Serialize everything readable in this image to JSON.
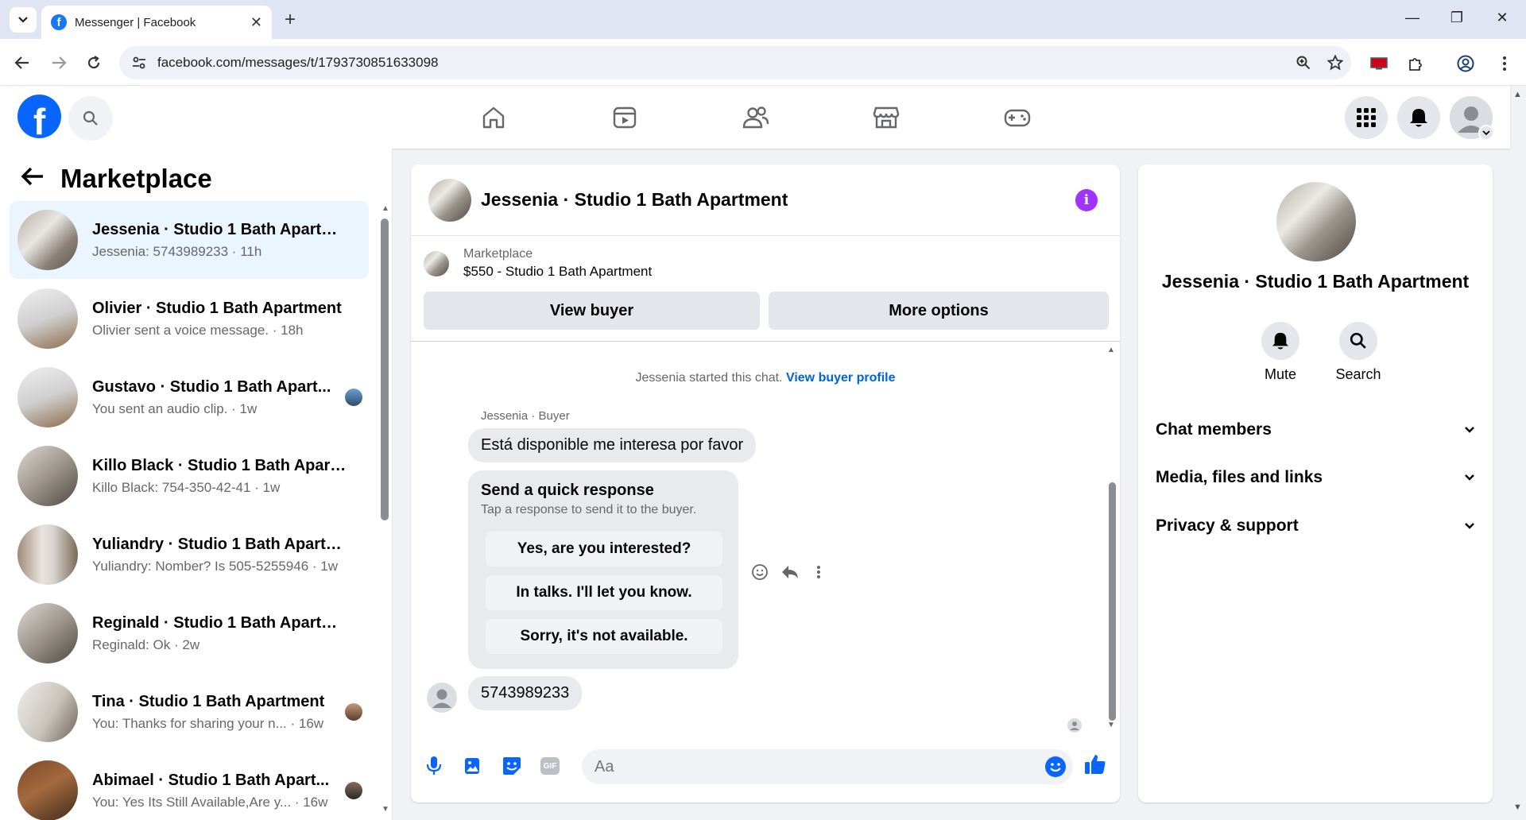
{
  "browser": {
    "tab_title": "Messenger | Facebook",
    "close_tab": "✕",
    "new_tab": "+",
    "url": "facebook.com/messages/t/1793730851633098",
    "win_min": "—",
    "win_max": "❐",
    "win_close": "✕"
  },
  "fb": {
    "logo": "f"
  },
  "sidebar": {
    "title": "Marketplace",
    "conversations": [
      {
        "name": "Jessenia · Studio 1 Bath Apartment",
        "preview": "Jessenia: 5743989233 · 11h",
        "active": true
      },
      {
        "name": "Olivier · Studio 1 Bath Apartment",
        "preview": "Olivier sent a voice message. · 18h"
      },
      {
        "name": "Gustavo · Studio 1 Bath Apart...",
        "preview": "You sent an audio clip. · 1w"
      },
      {
        "name": "Killo Black · Studio 1 Bath Apart...",
        "preview": "Killo Black: 754-350-42-41 · 1w"
      },
      {
        "name": "Yuliandry · Studio 1 Bath Apartm...",
        "preview": "Yuliandry: Nomber? Is 505-5255946 · 1w"
      },
      {
        "name": "Reginald · Studio 1 Bath Apartm...",
        "preview": "Reginald: Ok · 2w"
      },
      {
        "name": "Tina · Studio 1 Bath Apartment",
        "preview": "You: Thanks for sharing your n... · 16w"
      },
      {
        "name": "Abimael · Studio 1 Bath Apart...",
        "preview": "You: Yes Its Still Available,Are y... · 16w"
      }
    ]
  },
  "chat": {
    "header_name": "Jessenia · Studio 1 Bath Apartment",
    "info": "i",
    "marketplace_label": "Marketplace",
    "listing": "$550 - Studio 1 Bath Apartment",
    "view_buyer": "View buyer",
    "more_options": "More options",
    "started_text": "Jessenia started this chat.",
    "view_buyer_profile": "View buyer profile",
    "sender_label": "Jessenia · Buyer",
    "message1": "Está disponible me interesa por favor",
    "quick_title": "Send a quick response",
    "quick_sub": "Tap a response to send it to the buyer.",
    "quick_options": [
      "Yes, are you interested?",
      "In talks. I'll let you know.",
      "Sorry, it's not available."
    ],
    "message2": "5743989233",
    "composer_placeholder": "Aa",
    "gif_label": "GIF"
  },
  "right_panel": {
    "name": "Jessenia · Studio 1 Bath Apartment",
    "mute": "Mute",
    "search": "Search",
    "sections": [
      "Chat members",
      "Media, files and links",
      "Privacy & support"
    ]
  },
  "colors": {
    "accent": "#0866ff",
    "active_row": "#ebf5ff",
    "info": "#a033ff"
  }
}
